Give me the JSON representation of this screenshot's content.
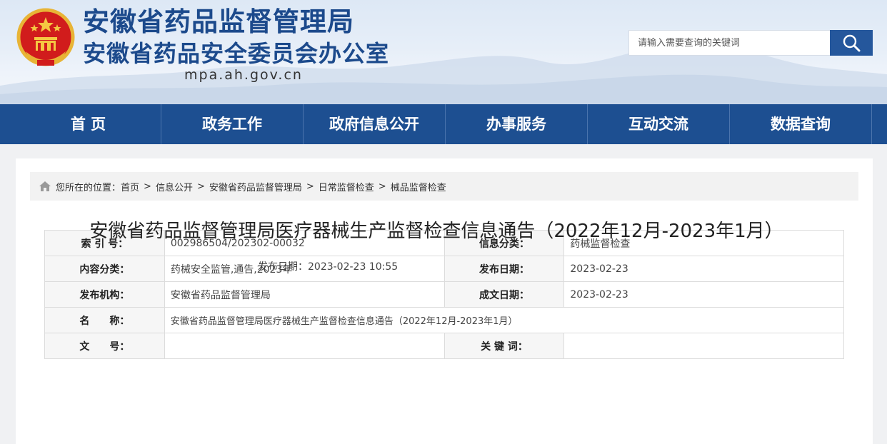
{
  "header": {
    "title": "安徽省药品监督管理局",
    "subtitle": "安徽省药品安全委员会办公室",
    "domain": "mpa.ah.gov.cn",
    "search_placeholder": "请输入需要查询的关键词"
  },
  "nav": {
    "items": [
      "首 页",
      "政务工作",
      "政府信息公开",
      "办事服务",
      "互动交流",
      "数据查询"
    ]
  },
  "breadcrumb": {
    "prefix": "您所在的位置：",
    "items": [
      "首页",
      "信息公开",
      "安徽省药品监督管理局",
      "日常监督检查",
      "械品监督检查"
    ],
    "separator": ">"
  },
  "meta": {
    "index_label": "索 引 号：",
    "index_value": "002986504/202302-00032",
    "category_label": "信息分类：",
    "category_value": "药械监督检查",
    "content_label": "内容分类：",
    "content_value": "药械安全监管,通告,2023年",
    "pubdate_label": "发布日期：",
    "pubdate_value": "2023-02-23",
    "org_label": "发布机构：",
    "org_value": "安徽省药品监督管理局",
    "made_label": "成文日期：",
    "made_value": "2023-02-23",
    "name_label": "名　　称：",
    "name_value": "安徽省药品监督管理局医疗器械生产监督检查信息通告（2022年12月-2023年1月）",
    "doc_label": "文　　号：",
    "doc_value": "",
    "keywords_label": "关 键 词：",
    "keywords_value": ""
  },
  "article": {
    "title": "安徽省药品监督管理局医疗器械生产监督检查信息通告（2022年12月-2023年1月）",
    "date": "发布日期：2023-02-23 10:55"
  },
  "colors": {
    "brand_blue": "#1d4f91",
    "title_blue": "#1c4a8c",
    "search_button": "#25579c"
  }
}
